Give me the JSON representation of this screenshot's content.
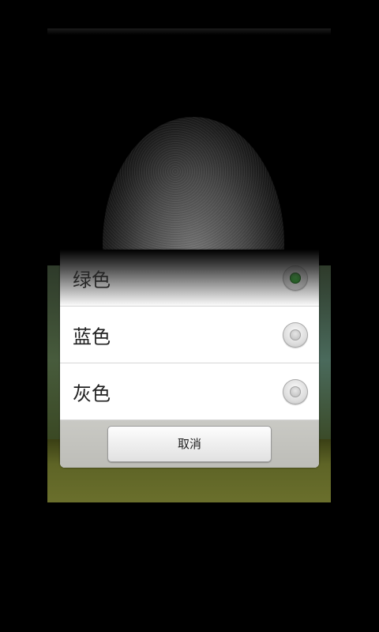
{
  "dialog": {
    "options": [
      {
        "label": "绿色",
        "selected": true
      },
      {
        "label": "蓝色",
        "selected": false
      },
      {
        "label": "灰色",
        "selected": false
      }
    ],
    "cancel_label": "取消"
  },
  "colors": {
    "selected_radio": "#1f8f1f",
    "footer": "#c4c4bf"
  }
}
